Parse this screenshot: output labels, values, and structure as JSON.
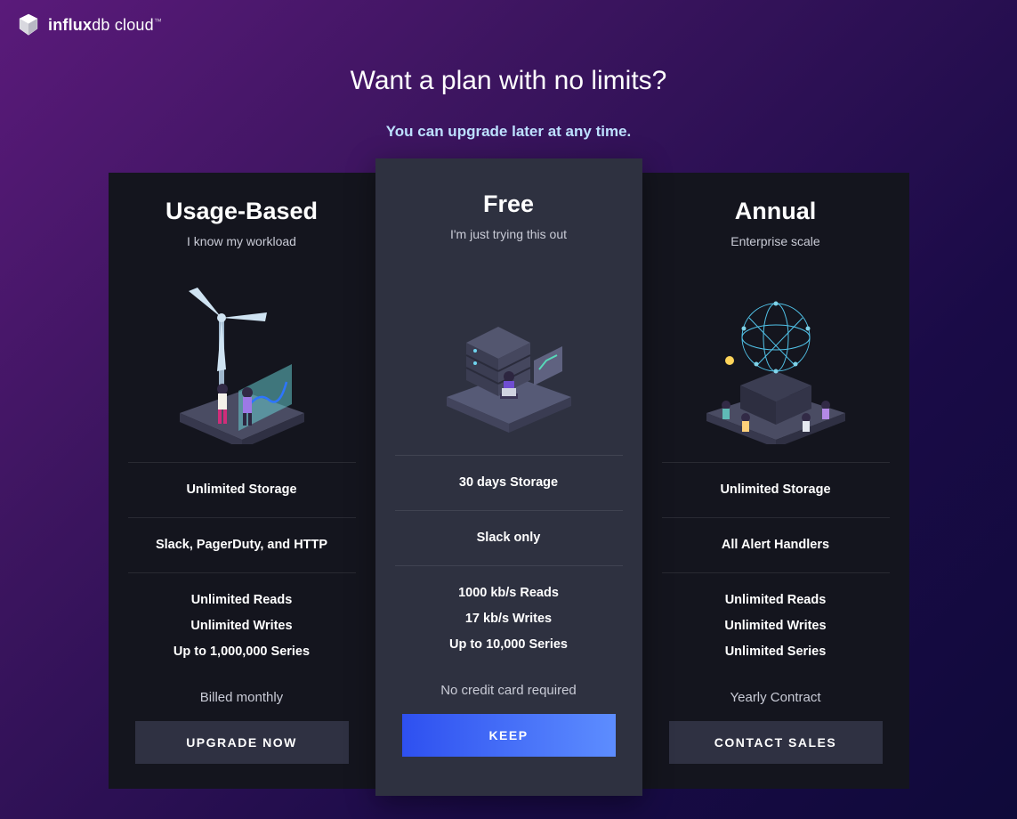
{
  "brand": {
    "name_bold": "influx",
    "name_light": "db cloud",
    "tm": "™"
  },
  "hero": {
    "title": "Want a plan with no limits?",
    "subtitle": "You can upgrade later at any time."
  },
  "plans": [
    {
      "id": "usage",
      "name": "Usage-Based",
      "tagline": "I know my workload",
      "features_top": [
        "Unlimited Storage"
      ],
      "features_mid": [
        "Slack, PagerDuty, and HTTP"
      ],
      "features_bot": [
        "Unlimited Reads",
        "Unlimited Writes",
        "Up to 1,000,000 Series"
      ],
      "billing": "Billed monthly",
      "cta": "UPGRADE NOW"
    },
    {
      "id": "free",
      "name": "Free",
      "tagline": "I'm just trying this out",
      "features_top": [
        "30 days Storage"
      ],
      "features_mid": [
        "Slack only"
      ],
      "features_bot": [
        "1000 kb/s Reads",
        "17 kb/s Writes",
        "Up to 10,000 Series"
      ],
      "billing": "No credit card required",
      "cta": "KEEP"
    },
    {
      "id": "annual",
      "name": "Annual",
      "tagline": "Enterprise scale",
      "features_top": [
        "Unlimited Storage"
      ],
      "features_mid": [
        "All Alert Handlers"
      ],
      "features_bot": [
        "Unlimited Reads",
        "Unlimited Writes",
        "Unlimited Series"
      ],
      "billing": "Yearly Contract",
      "cta": "CONTACT SALES"
    }
  ]
}
